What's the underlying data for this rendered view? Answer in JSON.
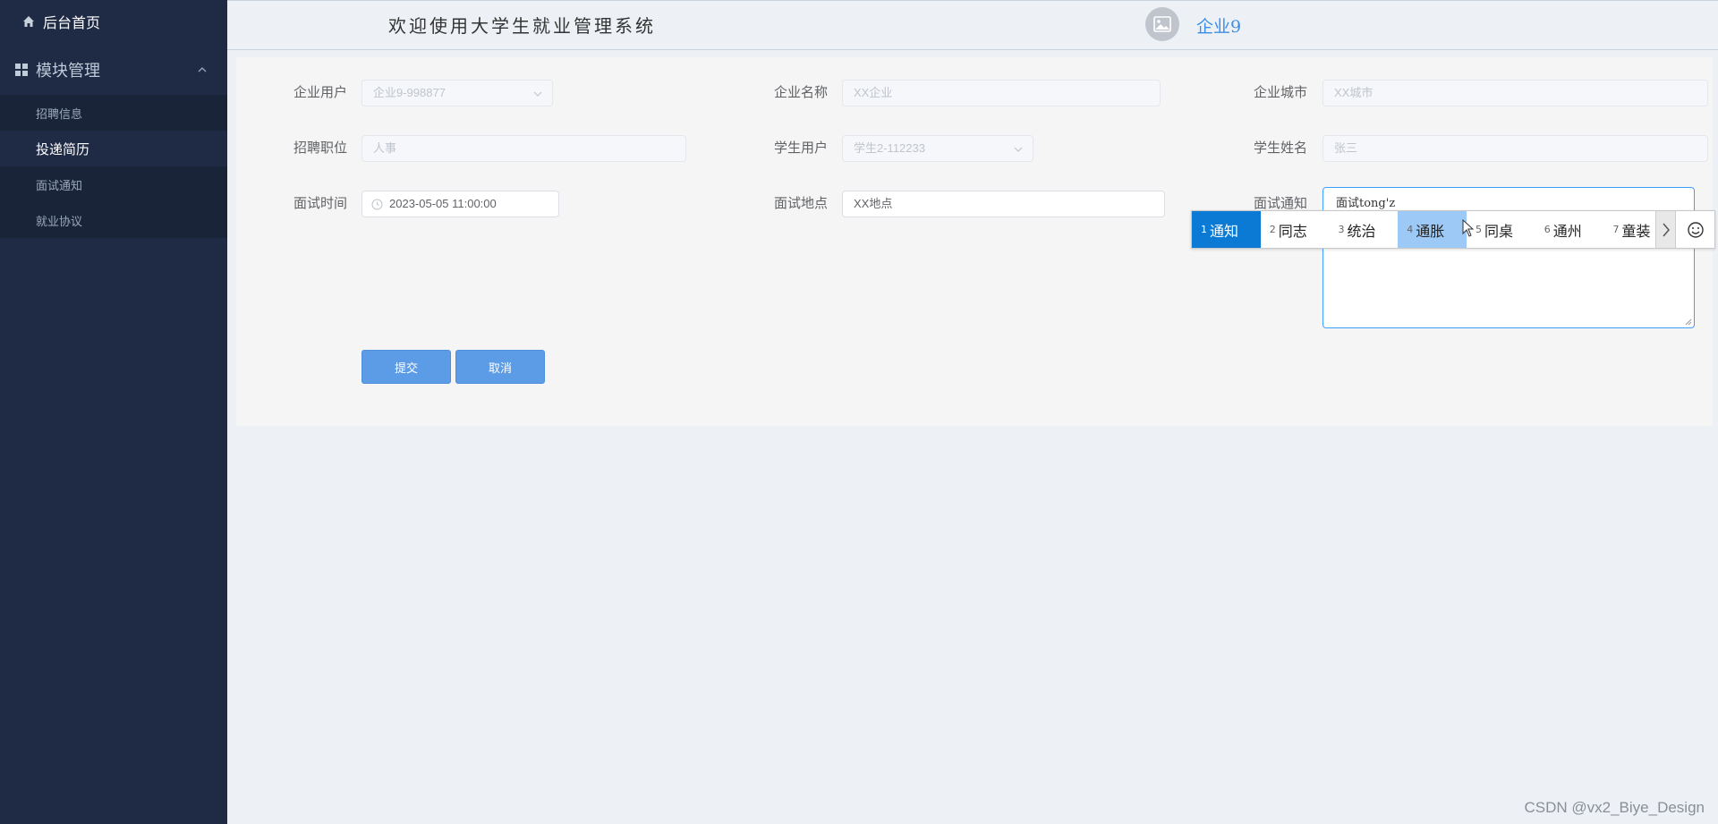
{
  "sidebar": {
    "home_label": "后台首页",
    "module_label": "模块管理",
    "items": [
      {
        "label": "招聘信息",
        "active": false
      },
      {
        "label": "投递简历",
        "active": true
      },
      {
        "label": "面试通知",
        "active": false
      },
      {
        "label": "就业协议",
        "active": false
      }
    ]
  },
  "header": {
    "title": "欢迎使用大学生就业管理系统",
    "user": "企业9"
  },
  "form": {
    "company_user": {
      "label": "企业用户",
      "value": "企业9-998877"
    },
    "company_name": {
      "label": "企业名称",
      "value": "XX企业"
    },
    "company_city": {
      "label": "企业城市",
      "value": "XX城市"
    },
    "position": {
      "label": "招聘职位",
      "value": "人事"
    },
    "student_user": {
      "label": "学生用户",
      "value": "学生2-112233"
    },
    "student_name": {
      "label": "学生姓名",
      "value": "张三"
    },
    "interview_time": {
      "label": "面试时间",
      "value": "2023-05-05 11:00:00"
    },
    "interview_place": {
      "label": "面试地点",
      "value": "XX地点"
    },
    "interview_notice": {
      "label": "面试通知",
      "value": "面试tong'z"
    },
    "submit_label": "提交",
    "cancel_label": "取消"
  },
  "ime": {
    "candidates": [
      {
        "num": "1",
        "text": "通知"
      },
      {
        "num": "2",
        "text": "同志"
      },
      {
        "num": "3",
        "text": "统治"
      },
      {
        "num": "4",
        "text": "通胀"
      },
      {
        "num": "5",
        "text": "同桌"
      },
      {
        "num": "6",
        "text": "通州"
      },
      {
        "num": "7",
        "text": "童装"
      }
    ]
  },
  "watermark": "CSDN @vx2_Biye_Design",
  "colors": {
    "sidebar_bg": "#1f2a44",
    "accent": "#409eff",
    "button": "#5c9be6",
    "ime_selected": "#0a7ad4"
  }
}
